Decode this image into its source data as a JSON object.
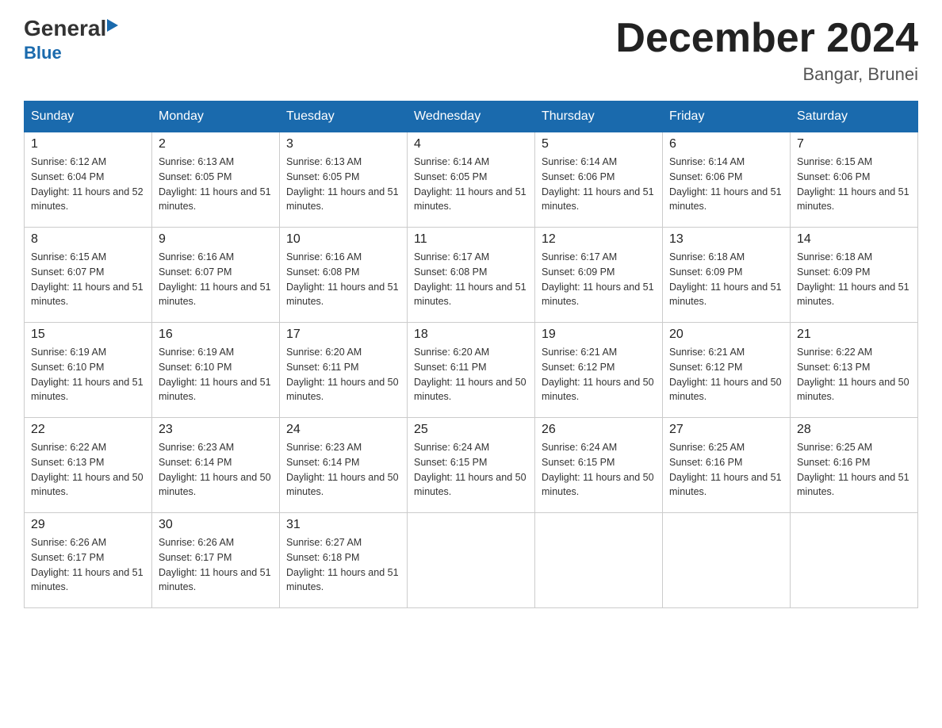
{
  "logo": {
    "general_text": "General",
    "blue_text": "Blue"
  },
  "title": {
    "month_year": "December 2024",
    "location": "Bangar, Brunei"
  },
  "days_of_week": [
    "Sunday",
    "Monday",
    "Tuesday",
    "Wednesday",
    "Thursday",
    "Friday",
    "Saturday"
  ],
  "weeks": [
    [
      {
        "day": "1",
        "sunrise": "Sunrise: 6:12 AM",
        "sunset": "Sunset: 6:04 PM",
        "daylight": "Daylight: 11 hours and 52 minutes."
      },
      {
        "day": "2",
        "sunrise": "Sunrise: 6:13 AM",
        "sunset": "Sunset: 6:05 PM",
        "daylight": "Daylight: 11 hours and 51 minutes."
      },
      {
        "day": "3",
        "sunrise": "Sunrise: 6:13 AM",
        "sunset": "Sunset: 6:05 PM",
        "daylight": "Daylight: 11 hours and 51 minutes."
      },
      {
        "day": "4",
        "sunrise": "Sunrise: 6:14 AM",
        "sunset": "Sunset: 6:05 PM",
        "daylight": "Daylight: 11 hours and 51 minutes."
      },
      {
        "day": "5",
        "sunrise": "Sunrise: 6:14 AM",
        "sunset": "Sunset: 6:06 PM",
        "daylight": "Daylight: 11 hours and 51 minutes."
      },
      {
        "day": "6",
        "sunrise": "Sunrise: 6:14 AM",
        "sunset": "Sunset: 6:06 PM",
        "daylight": "Daylight: 11 hours and 51 minutes."
      },
      {
        "day": "7",
        "sunrise": "Sunrise: 6:15 AM",
        "sunset": "Sunset: 6:06 PM",
        "daylight": "Daylight: 11 hours and 51 minutes."
      }
    ],
    [
      {
        "day": "8",
        "sunrise": "Sunrise: 6:15 AM",
        "sunset": "Sunset: 6:07 PM",
        "daylight": "Daylight: 11 hours and 51 minutes."
      },
      {
        "day": "9",
        "sunrise": "Sunrise: 6:16 AM",
        "sunset": "Sunset: 6:07 PM",
        "daylight": "Daylight: 11 hours and 51 minutes."
      },
      {
        "day": "10",
        "sunrise": "Sunrise: 6:16 AM",
        "sunset": "Sunset: 6:08 PM",
        "daylight": "Daylight: 11 hours and 51 minutes."
      },
      {
        "day": "11",
        "sunrise": "Sunrise: 6:17 AM",
        "sunset": "Sunset: 6:08 PM",
        "daylight": "Daylight: 11 hours and 51 minutes."
      },
      {
        "day": "12",
        "sunrise": "Sunrise: 6:17 AM",
        "sunset": "Sunset: 6:09 PM",
        "daylight": "Daylight: 11 hours and 51 minutes."
      },
      {
        "day": "13",
        "sunrise": "Sunrise: 6:18 AM",
        "sunset": "Sunset: 6:09 PM",
        "daylight": "Daylight: 11 hours and 51 minutes."
      },
      {
        "day": "14",
        "sunrise": "Sunrise: 6:18 AM",
        "sunset": "Sunset: 6:09 PM",
        "daylight": "Daylight: 11 hours and 51 minutes."
      }
    ],
    [
      {
        "day": "15",
        "sunrise": "Sunrise: 6:19 AM",
        "sunset": "Sunset: 6:10 PM",
        "daylight": "Daylight: 11 hours and 51 minutes."
      },
      {
        "day": "16",
        "sunrise": "Sunrise: 6:19 AM",
        "sunset": "Sunset: 6:10 PM",
        "daylight": "Daylight: 11 hours and 51 minutes."
      },
      {
        "day": "17",
        "sunrise": "Sunrise: 6:20 AM",
        "sunset": "Sunset: 6:11 PM",
        "daylight": "Daylight: 11 hours and 50 minutes."
      },
      {
        "day": "18",
        "sunrise": "Sunrise: 6:20 AM",
        "sunset": "Sunset: 6:11 PM",
        "daylight": "Daylight: 11 hours and 50 minutes."
      },
      {
        "day": "19",
        "sunrise": "Sunrise: 6:21 AM",
        "sunset": "Sunset: 6:12 PM",
        "daylight": "Daylight: 11 hours and 50 minutes."
      },
      {
        "day": "20",
        "sunrise": "Sunrise: 6:21 AM",
        "sunset": "Sunset: 6:12 PM",
        "daylight": "Daylight: 11 hours and 50 minutes."
      },
      {
        "day": "21",
        "sunrise": "Sunrise: 6:22 AM",
        "sunset": "Sunset: 6:13 PM",
        "daylight": "Daylight: 11 hours and 50 minutes."
      }
    ],
    [
      {
        "day": "22",
        "sunrise": "Sunrise: 6:22 AM",
        "sunset": "Sunset: 6:13 PM",
        "daylight": "Daylight: 11 hours and 50 minutes."
      },
      {
        "day": "23",
        "sunrise": "Sunrise: 6:23 AM",
        "sunset": "Sunset: 6:14 PM",
        "daylight": "Daylight: 11 hours and 50 minutes."
      },
      {
        "day": "24",
        "sunrise": "Sunrise: 6:23 AM",
        "sunset": "Sunset: 6:14 PM",
        "daylight": "Daylight: 11 hours and 50 minutes."
      },
      {
        "day": "25",
        "sunrise": "Sunrise: 6:24 AM",
        "sunset": "Sunset: 6:15 PM",
        "daylight": "Daylight: 11 hours and 50 minutes."
      },
      {
        "day": "26",
        "sunrise": "Sunrise: 6:24 AM",
        "sunset": "Sunset: 6:15 PM",
        "daylight": "Daylight: 11 hours and 50 minutes."
      },
      {
        "day": "27",
        "sunrise": "Sunrise: 6:25 AM",
        "sunset": "Sunset: 6:16 PM",
        "daylight": "Daylight: 11 hours and 51 minutes."
      },
      {
        "day": "28",
        "sunrise": "Sunrise: 6:25 AM",
        "sunset": "Sunset: 6:16 PM",
        "daylight": "Daylight: 11 hours and 51 minutes."
      }
    ],
    [
      {
        "day": "29",
        "sunrise": "Sunrise: 6:26 AM",
        "sunset": "Sunset: 6:17 PM",
        "daylight": "Daylight: 11 hours and 51 minutes."
      },
      {
        "day": "30",
        "sunrise": "Sunrise: 6:26 AM",
        "sunset": "Sunset: 6:17 PM",
        "daylight": "Daylight: 11 hours and 51 minutes."
      },
      {
        "day": "31",
        "sunrise": "Sunrise: 6:27 AM",
        "sunset": "Sunset: 6:18 PM",
        "daylight": "Daylight: 11 hours and 51 minutes."
      },
      null,
      null,
      null,
      null
    ]
  ]
}
